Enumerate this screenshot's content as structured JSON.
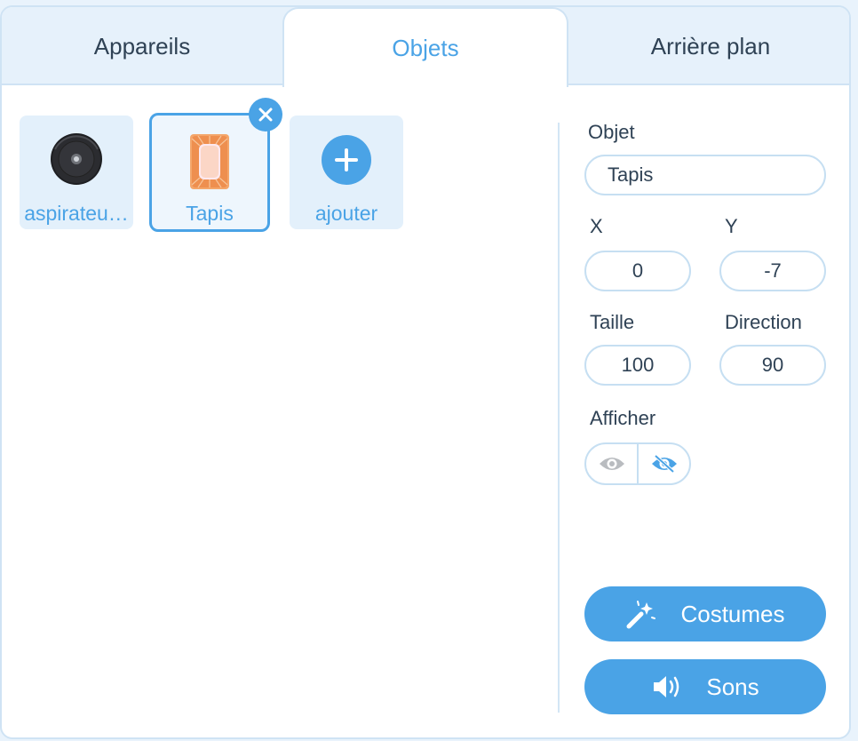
{
  "tabs": [
    {
      "label": "Appareils"
    },
    {
      "label": "Objets"
    },
    {
      "label": "Arrière plan"
    }
  ],
  "active_tab": "Objets",
  "sprites": [
    {
      "label": "aspirateu…",
      "icon": "robot-vacuum-icon"
    },
    {
      "label": "Tapis",
      "icon": "rug-icon",
      "selected": true
    },
    {
      "label": "ajouter",
      "icon": "plus-icon"
    }
  ],
  "properties": {
    "object_label": "Objet",
    "object_value": "Tapis",
    "x_label": "X",
    "x_value": "0",
    "y_label": "Y",
    "y_value": "-7",
    "size_label": "Taille",
    "size_value": "100",
    "direction_label": "Direction",
    "direction_value": "90",
    "show_label": "Afficher",
    "show_state": "hidden"
  },
  "buttons": {
    "costumes": "Costumes",
    "sounds": "Sons"
  },
  "colors": {
    "accent": "#4aa3e6",
    "text": "#2f4255",
    "border": "#c6dff2"
  }
}
